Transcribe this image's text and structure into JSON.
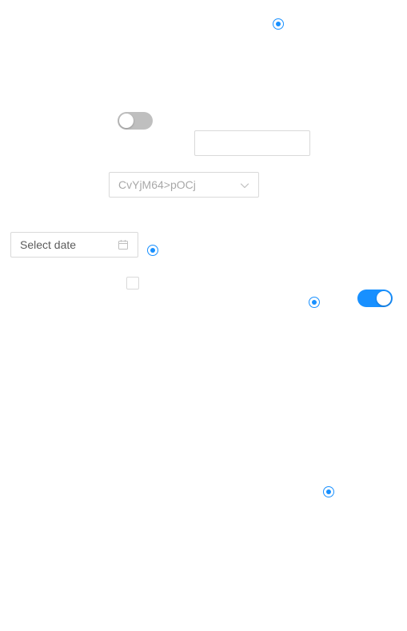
{
  "colors": {
    "accent": "#1890ff",
    "switch_off": "#bfbfbf",
    "border": "#d9d9d9",
    "muted_text": "#a6a6a6"
  },
  "radios": [
    {
      "checked": true
    },
    {
      "checked": true
    },
    {
      "checked": true
    },
    {
      "checked": true
    }
  ],
  "switches": [
    {
      "checked": false
    },
    {
      "checked": true
    }
  ],
  "text_input": {
    "value": "",
    "placeholder": ""
  },
  "select": {
    "selected_value": "CvYjM64>pOCj",
    "icon": "chevron-down-icon"
  },
  "date_picker": {
    "placeholder": "Select date",
    "icon": "calendar-icon"
  },
  "checkbox": {
    "checked": false
  }
}
